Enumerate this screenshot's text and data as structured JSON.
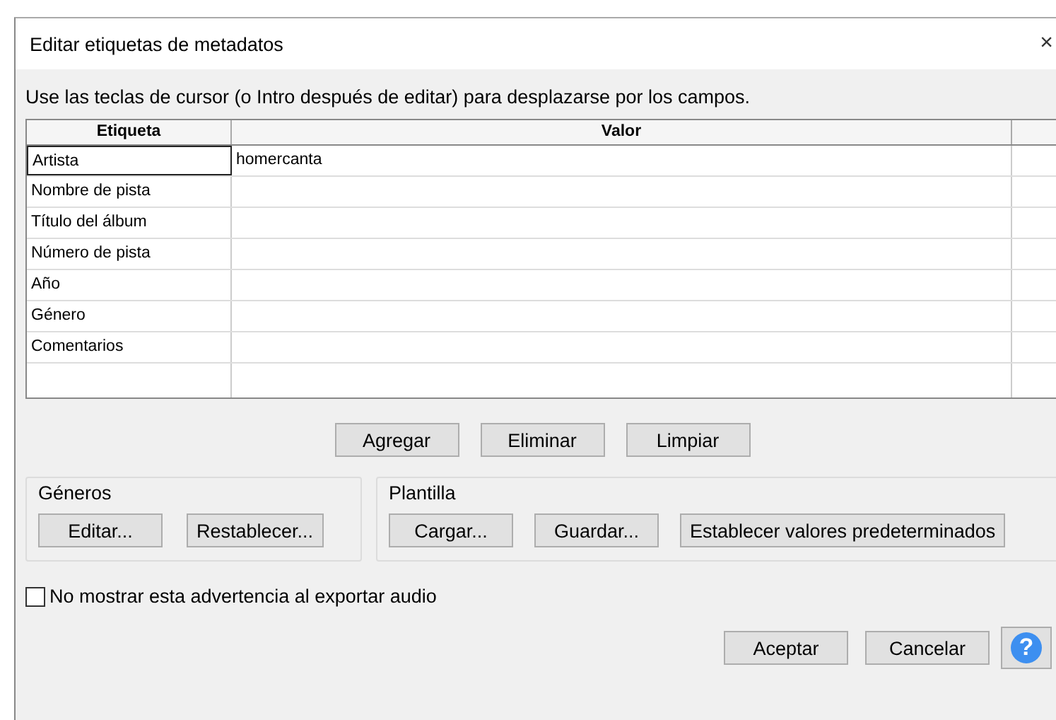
{
  "window": {
    "title": "Editar etiquetas de metadatos",
    "close": "×"
  },
  "instructions": "Use las teclas de cursor (o Intro después de editar) para desplazarse por los campos.",
  "table": {
    "columns": [
      "Etiqueta",
      "Valor"
    ],
    "rows": [
      {
        "tag": "Artista",
        "value": "homercanta",
        "selected": true
      },
      {
        "tag": "Nombre de pista",
        "selected": false
      },
      {
        "tag": "Título del álbum",
        "selected": false
      },
      {
        "tag": "Número de pista",
        "selected": false
      },
      {
        "tag": "Año",
        "selected": false
      },
      {
        "tag": "Género",
        "selected": false
      },
      {
        "tag": "Comentarios",
        "selected": false
      }
    ]
  },
  "row_buttons": [
    {
      "label": "Agregar"
    },
    {
      "label": "Eliminar"
    },
    {
      "label": "Limpiar"
    }
  ],
  "groups": [
    {
      "title": "Géneros",
      "buttons": [
        {
          "label": "Editar..."
        },
        {
          "label": "Restablecer..."
        }
      ]
    },
    {
      "title": "Plantilla",
      "buttons": [
        {
          "label": "Cargar..."
        },
        {
          "label": "Guardar..."
        },
        {
          "label": "Establecer valores predeterminados"
        }
      ]
    }
  ],
  "checkbox": {
    "label": "No mostrar esta advertencia al exportar audio",
    "checked": false
  },
  "dialog_buttons": [
    {
      "label": "Aceptar"
    },
    {
      "label": "Cancelar"
    }
  ],
  "help_button": {
    "label": "?"
  }
}
